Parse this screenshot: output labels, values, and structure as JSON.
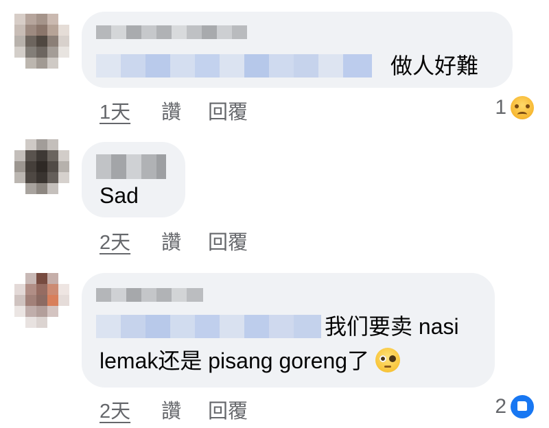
{
  "comments": [
    {
      "name_hidden": true,
      "text": "做人好難",
      "actions": {
        "time": "1天",
        "like": "讚",
        "reply": "回覆"
      },
      "reaction": {
        "count": "1",
        "icon": "sad-reaction-icon"
      }
    },
    {
      "name_hidden": true,
      "text": "Sad",
      "actions": {
        "time": "2天",
        "like": "讚",
        "reply": "回覆"
      }
    },
    {
      "name_hidden": true,
      "text_line1": "我们要卖 nasi",
      "text_line2": "lemak还是 pisang goreng了",
      "inline_emoji": "pleading-face-icon",
      "actions": {
        "time": "2天",
        "like": "讚",
        "reply": "回覆"
      },
      "reaction": {
        "count": "2",
        "icon": "like-reaction-icon"
      }
    }
  ],
  "colors": {
    "bubble": "#f0f2f5",
    "secondary_text": "#65676b",
    "like_blue": "#1877f2"
  }
}
